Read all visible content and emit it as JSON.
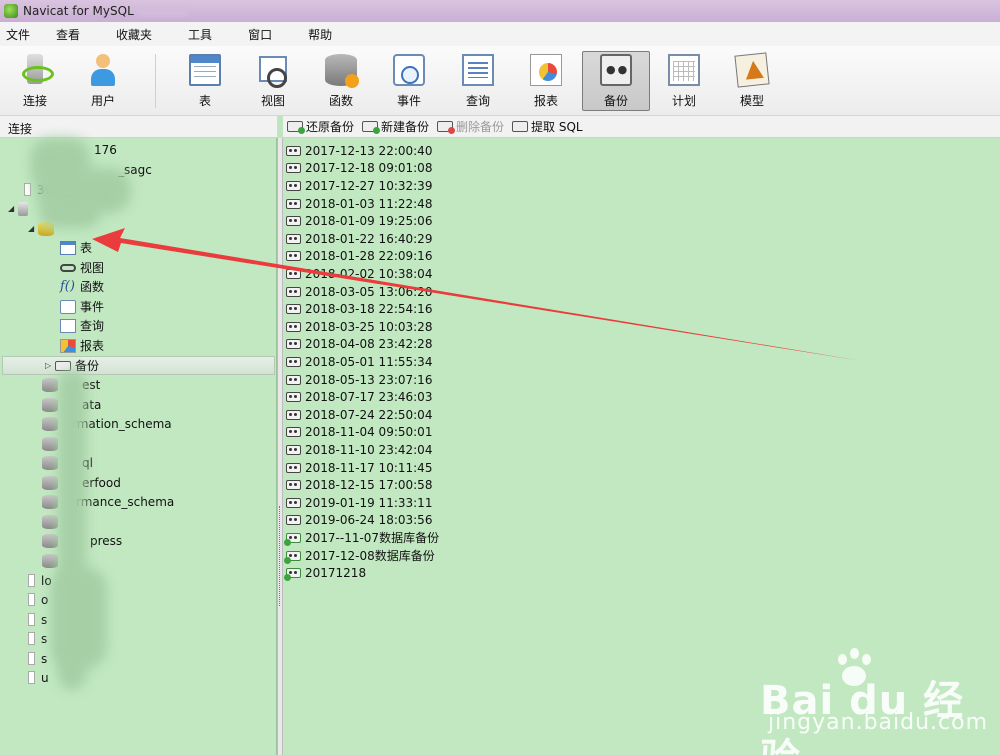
{
  "window": {
    "title": "Navicat for MySQL"
  },
  "menu": [
    "文件",
    "查看",
    "收藏夹",
    "工具",
    "窗口",
    "帮助"
  ],
  "toolbar": {
    "buttons": [
      {
        "label": "连接",
        "icon": "connection-icon"
      },
      {
        "label": "用户",
        "icon": "user-icon"
      },
      {
        "label": "表",
        "icon": "table-icon"
      },
      {
        "label": "视图",
        "icon": "view-icon"
      },
      {
        "label": "函数",
        "icon": "function-icon"
      },
      {
        "label": "事件",
        "icon": "event-icon"
      },
      {
        "label": "查询",
        "icon": "query-icon"
      },
      {
        "label": "报表",
        "icon": "report-icon"
      },
      {
        "label": "备份",
        "icon": "backup-icon",
        "active": true
      },
      {
        "label": "计划",
        "icon": "schedule-icon"
      },
      {
        "label": "模型",
        "icon": "model-icon"
      }
    ]
  },
  "left": {
    "header": "连接",
    "tree": [
      {
        "text": "176"
      },
      {
        "text": "_sagc"
      },
      {
        "text": "39"
      },
      {
        "text": ""
      },
      {
        "text": ""
      },
      {
        "text": "表",
        "icon": "table-icon"
      },
      {
        "text": "视图",
        "icon": "view-icon"
      },
      {
        "text": "函数",
        "icon": "function-icon"
      },
      {
        "text": "事件",
        "icon": "event-icon"
      },
      {
        "text": "查询",
        "icon": "query-icon"
      },
      {
        "text": "报表",
        "icon": "report-icon"
      },
      {
        "text": "备份",
        "icon": "backup-icon",
        "selected": true
      },
      {
        "text": "est"
      },
      {
        "text": "ata"
      },
      {
        "text": "rmation_schema"
      },
      {
        "text": ""
      },
      {
        "text": "ql"
      },
      {
        "text": "erfood"
      },
      {
        "text": "rmance_schema"
      },
      {
        "text": ""
      },
      {
        "text": "press"
      },
      {
        "text": ""
      },
      {
        "text": "lo"
      },
      {
        "text": "o"
      },
      {
        "text": "s"
      },
      {
        "text": "s"
      },
      {
        "text": "s"
      },
      {
        "text": "u"
      }
    ]
  },
  "object_toolbar": {
    "restore": "还原备份",
    "new": "新建备份",
    "delete": "删除备份",
    "extract": "提取 SQL"
  },
  "backups": [
    "2017-12-13 22:00:40",
    "2017-12-18 09:01:08",
    "2017-12-27 10:32:39",
    "2018-01-03 11:22:48",
    "2018-01-09 19:25:06",
    "2018-01-22 16:40:29",
    "2018-01-28 22:09:16",
    "2018-02-02 10:38:04",
    "2018-03-05 13:06:20",
    "2018-03-18 22:54:16",
    "2018-03-25 10:03:28",
    "2018-04-08 23:42:28",
    "2018-05-01 11:55:34",
    "2018-05-13 23:07:16",
    "2018-07-17 23:46:03",
    "2018-07-24 22:50:04",
    "2018-11-04 09:50:01",
    "2018-11-10 23:42:04",
    "2018-11-17 10:11:45",
    "2018-12-15 17:00:58",
    "2019-01-19 11:33:11",
    "2019-06-24 18:03:56",
    "2017--11-07数据库备份",
    "2017-12-08数据库备份",
    "20171218"
  ],
  "watermark": {
    "brand": "Bai du 经验",
    "url": "jingyan.baidu.com"
  },
  "colors": {
    "pane_bg": "#c2e8c2",
    "arrow": "#ea3c3c",
    "title_bg": "#d9c4e0"
  }
}
